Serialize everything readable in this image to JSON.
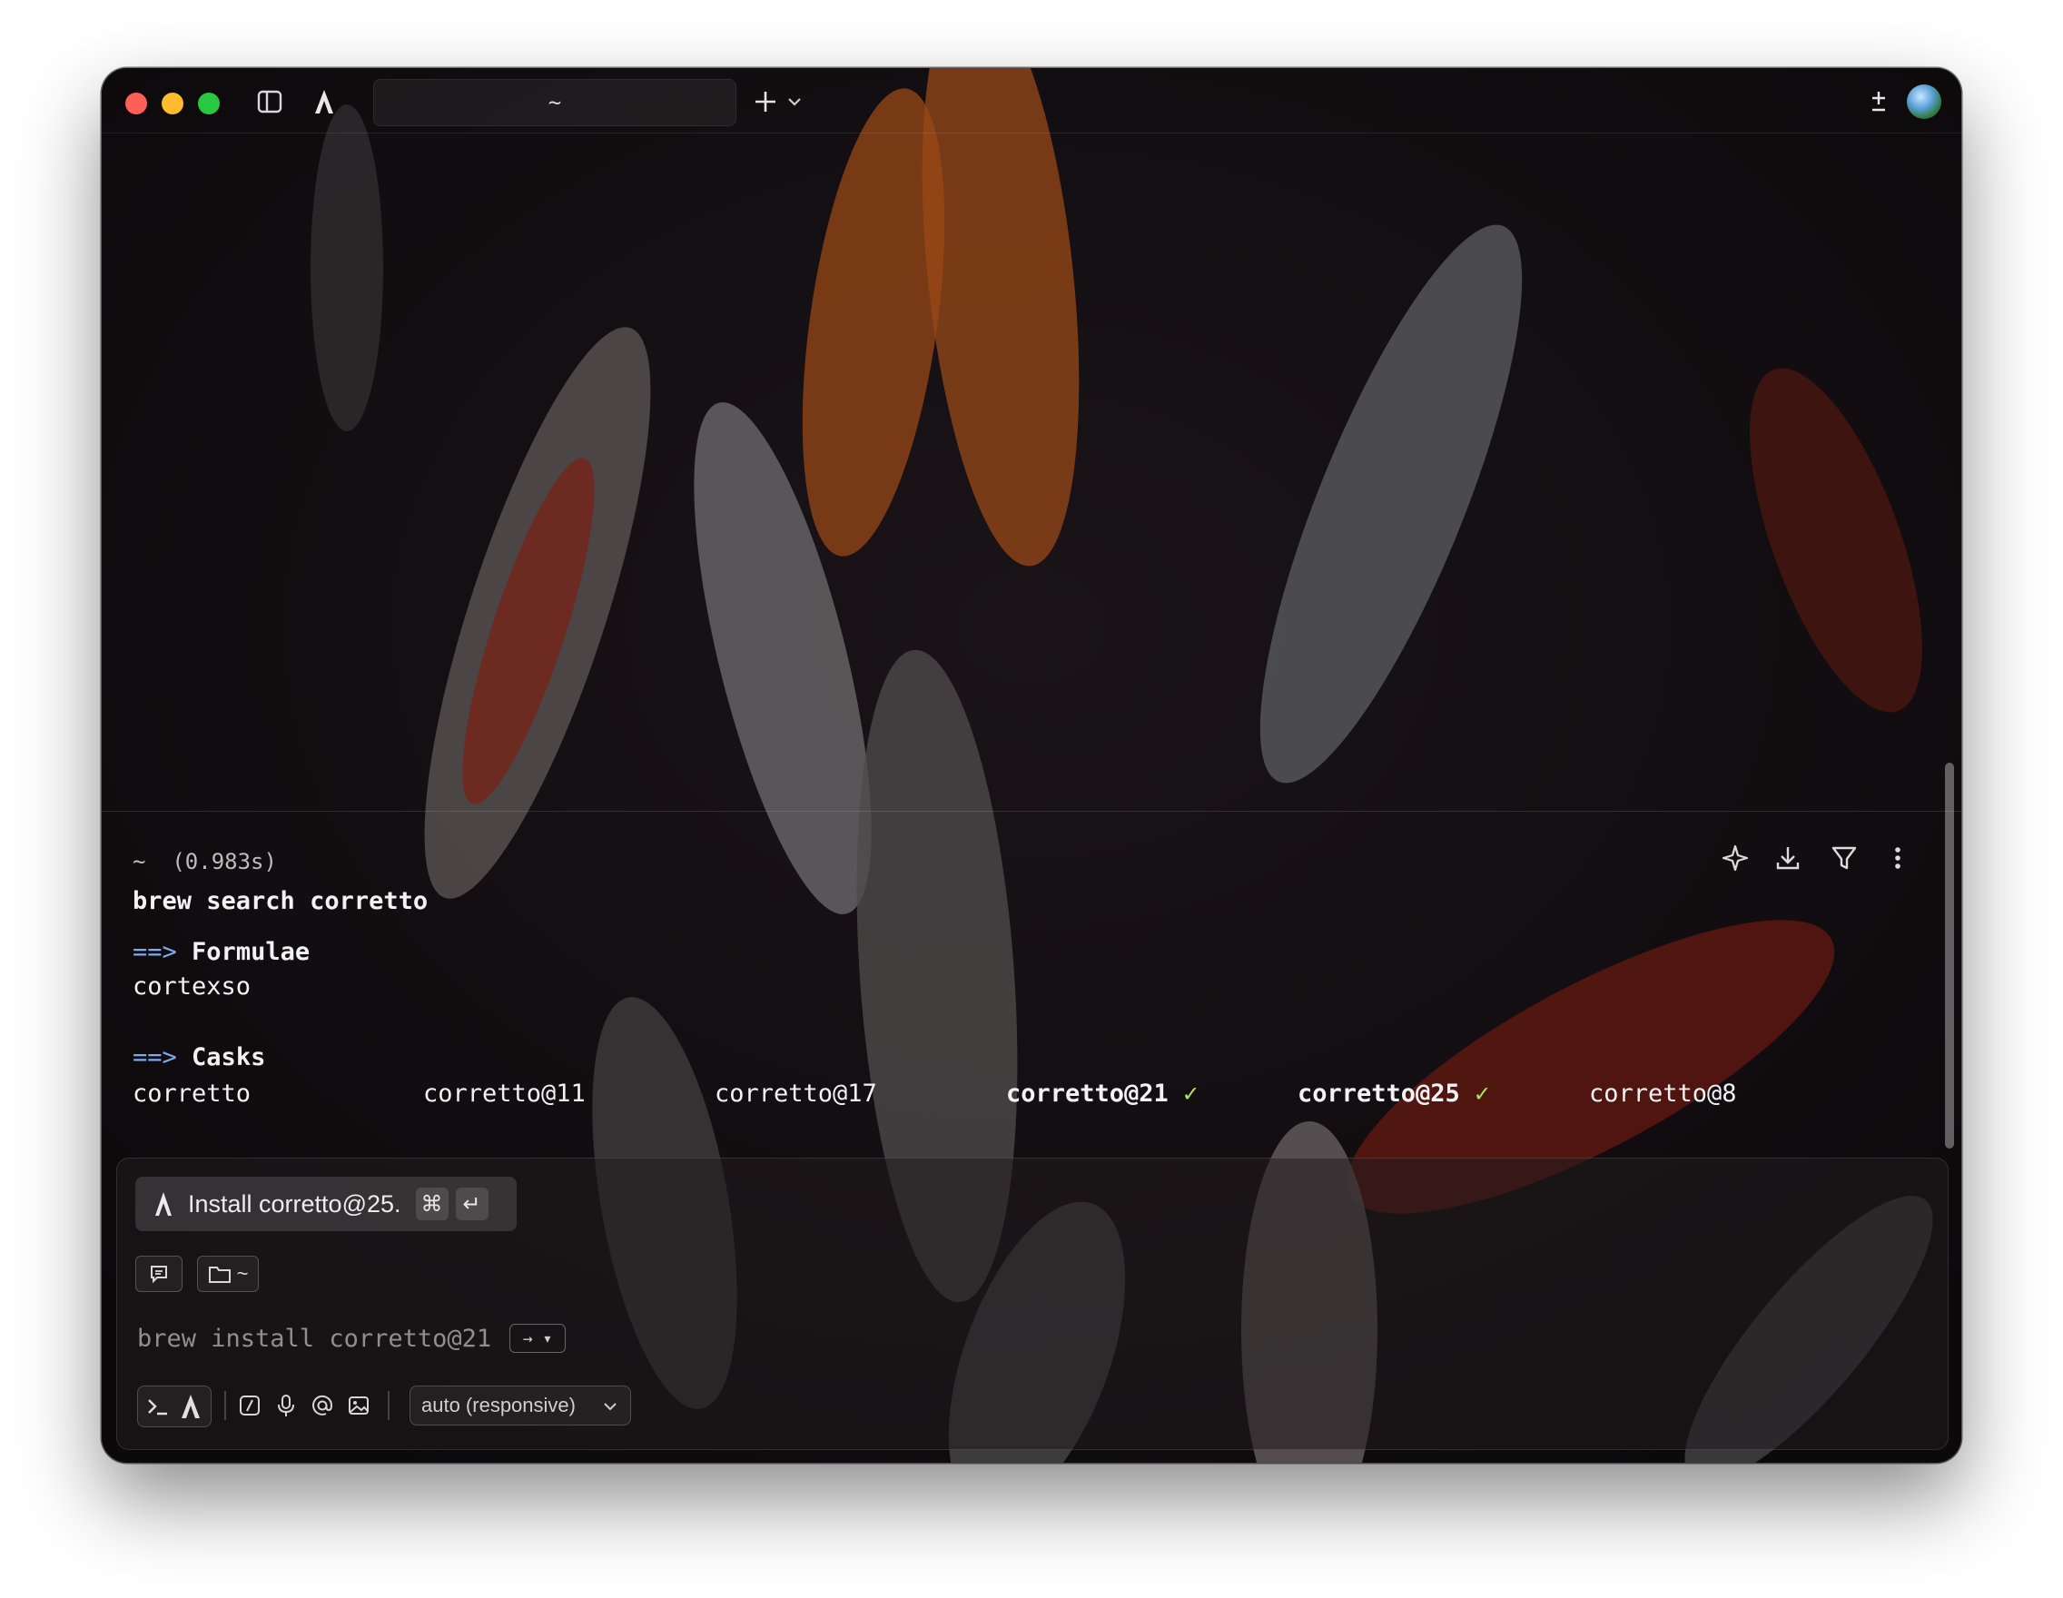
{
  "window": {
    "tab_title": "~"
  },
  "block": {
    "meta_dir": "~",
    "meta_time": "(0.983s)",
    "command": "brew search corretto",
    "formulae_arrow": "==>",
    "formulae_heading": "Formulae",
    "formulae": [
      "cortexso"
    ],
    "casks_arrow": "==>",
    "casks_heading": "Casks",
    "casks": [
      {
        "name": "corretto",
        "installed": false
      },
      {
        "name": "corretto@11",
        "installed": false
      },
      {
        "name": "corretto@17",
        "installed": false
      },
      {
        "name": "corretto@21",
        "installed": true
      },
      {
        "name": "corretto@25",
        "installed": true
      },
      {
        "name": "corretto@8",
        "installed": false
      }
    ],
    "check_mark": "✓"
  },
  "input": {
    "suggestion_text": "Install corretto@25.",
    "suggestion_key1": "⌘",
    "suggestion_key2": "↵",
    "dir_chip": "~",
    "ghost_command": "brew install corretto@21",
    "tab_hint": "→ ▾",
    "model_label": "auto (responsive)"
  },
  "colors": {
    "accent_prompt": "#7eaaf0",
    "installed_check": "#b4e35c"
  }
}
